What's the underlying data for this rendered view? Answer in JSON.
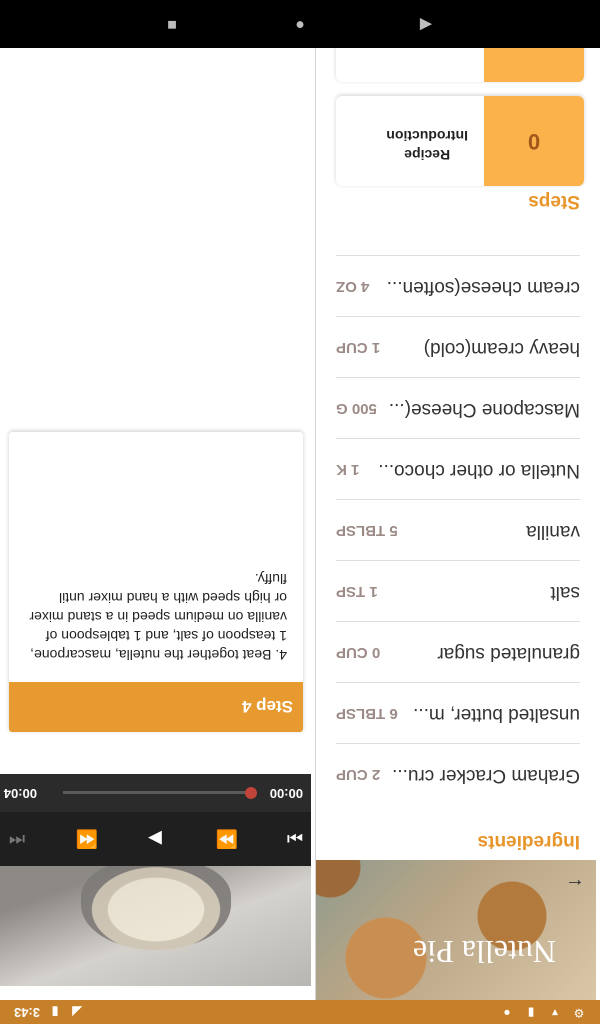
{
  "status_bar": {
    "time": "3:43",
    "left_icons": [
      "gear-icon",
      "alert-icon",
      "sd-card-icon",
      "circle-icon"
    ],
    "right_icons": [
      "signal-icon",
      "battery-icon"
    ]
  },
  "nav_bar": {
    "icons": [
      "back-icon",
      "home-icon",
      "recents-icon"
    ]
  },
  "recipe": {
    "title": "Nutella Pie"
  },
  "ingredients": {
    "heading": "Ingredients",
    "items": [
      {
        "name": "Graham Cracker cru...",
        "qty": "2 CUP"
      },
      {
        "name": "unsalted butter, m...",
        "qty": "6 TBLSP"
      },
      {
        "name": "granulated sugar",
        "qty": "0 CUP"
      },
      {
        "name": "salt",
        "qty": "1 TSP"
      },
      {
        "name": "vanilla",
        "qty": "5 TBLSP"
      },
      {
        "name": "Nutella or other choco...",
        "qty": "1 K"
      },
      {
        "name": "Mascapone Cheese(...",
        "qty": "500 G"
      },
      {
        "name": "heavy cream(cold)",
        "qty": "1 CUP"
      },
      {
        "name": "cream cheese(soften...",
        "qty": "4 OZ"
      }
    ]
  },
  "steps": {
    "heading": "Steps",
    "items": [
      {
        "number": "0",
        "label_line1": "Recipe",
        "label_line2": "Introduction"
      },
      {
        "number": "",
        "label_line1": "",
        "label_line2": ""
      }
    ]
  },
  "player": {
    "current_time": "00:00",
    "duration": "00:04",
    "progress": 0.0,
    "icons": [
      "skip-previous-icon",
      "rewind-icon",
      "play-icon",
      "fast-forward-icon",
      "skip-next-icon"
    ]
  },
  "step_detail": {
    "title": "Step 4",
    "text": "4. Beat together the nutella, mascarpone, 1 teaspoon of salt, and 1 tablespoon of vanilla on medium speed in a stand mixer or high speed with a hand mixer until fluffy."
  },
  "colors": {
    "accent": "#e8952c",
    "status_bar": "#c6802a",
    "step_number_bg": "#fbb24a"
  }
}
